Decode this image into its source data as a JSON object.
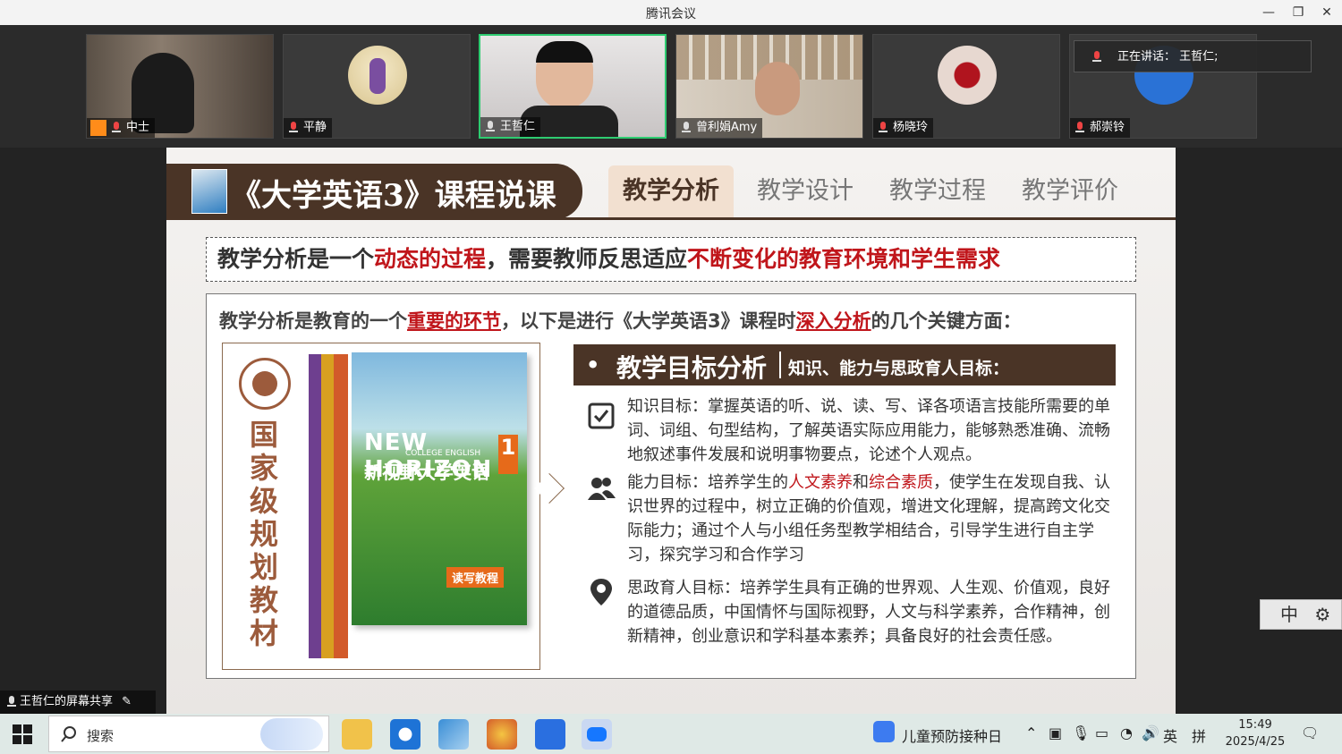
{
  "window": {
    "title": "腾讯会议",
    "minimize": "—",
    "restore": "❐",
    "close": "✕"
  },
  "participants": [
    {
      "name": "中士",
      "muted": true
    },
    {
      "name": "平静",
      "muted": true
    },
    {
      "name": "王哲仁",
      "muted": false
    },
    {
      "name": "曾利娟Amy",
      "muted": false
    },
    {
      "name": "杨晓玲",
      "muted": true
    },
    {
      "name": "郝崇铃",
      "muted": true
    }
  ],
  "speaking": {
    "label": "正在讲话：",
    "name": "王哲仁;"
  },
  "slide": {
    "course_title": "《大学英语3》课程说课",
    "tabs": [
      "教学分析",
      "教学设计",
      "教学过程",
      "教学评价"
    ],
    "active_tab": "教学分析",
    "banner": {
      "part1": "教学分析是一个",
      "part2": "动态的过程",
      "part3": "，需要教师反思适应",
      "part4": "不断变化的教育环境和学生需求"
    },
    "intro": {
      "part1": "教学分析是教育的一个",
      "part2": "重要的环节",
      "part3": "，以下是进行《大学英语3》课程时",
      "part4": "深入分析",
      "part5": "的几个关键方面："
    },
    "book": {
      "vertical_label": [
        "国",
        "家",
        "级",
        "规",
        "划",
        "教",
        "材"
      ],
      "logo": "NEW HORIZON",
      "subtitle": "COLLEGE ENGLISH",
      "title": "新视野大学英语",
      "volume": "1",
      "tag": "读写教程"
    },
    "objectives": {
      "bullet": "•",
      "title": "教学目标分析",
      "subtitle": "知识、能力与思政育人目标：",
      "knowledge": "知识目标：掌握英语的听、说、读、写、译各项语言技能所需要的单词、词组、句型结构，了解英语实际应用能力，能够熟悉准确、流畅地叙述事件发展和说明事物要点，论述个人观点。",
      "ability": {
        "a": "能力目标：培养学生的",
        "b": "人文素养",
        "c": "和",
        "d": "综合素质",
        "e": "，使学生在发现自我、认识世界的过程中，树立正确的价值观，增进文化理解，提高跨文化交际能力；通过个人与小组任务型教学相结合，引导学生进行自主学习，探究学习和合作学习"
      },
      "ideology": "思政育人目标：培养学生具有正确的世界观、人生观、价值观，良好的道德品质，中国情怀与国际视野，人文与科学素养，合作精神，创新精神，创业意识和学科基本素养；具备良好的社会责任感。"
    }
  },
  "share_label": "王哲仁的屏幕共享",
  "ime_widget": {
    "mode": "中",
    "settings": "⚙"
  },
  "taskbar": {
    "search_placeholder": "搜索",
    "news": "儿童预防接种日",
    "lang": "英",
    "ime": "拼",
    "time": "15:49",
    "date": "2025/4/25"
  },
  "colors": {
    "brand_brown": "#4a3426",
    "accent_red": "#c0161b",
    "active_green": "#2ecc71"
  }
}
